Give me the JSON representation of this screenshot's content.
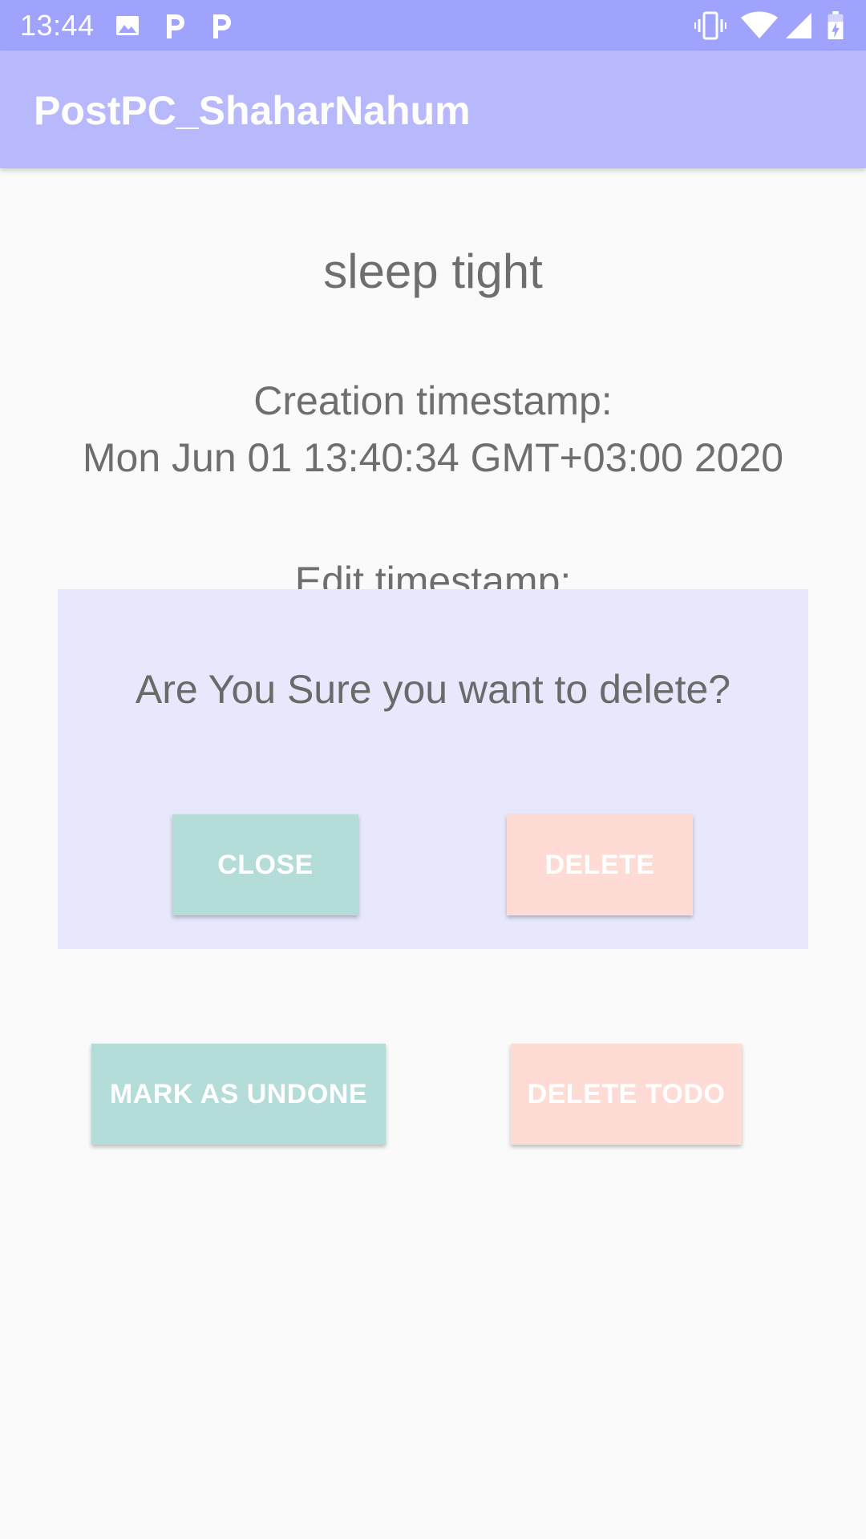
{
  "status_bar": {
    "time": "13:44",
    "icons": [
      "image-icon",
      "parking-icon",
      "parking-icon",
      "vibrate-icon",
      "wifi-icon",
      "signal-icon",
      "battery-icon"
    ]
  },
  "app_bar": {
    "title": "PostPC_ShaharNahum"
  },
  "todo": {
    "title": "sleep tight",
    "creation_label": "Creation timestamp:",
    "creation_value": "Mon Jun 01 13:40:34 GMT+03:00 2020",
    "edit_label": "Edit timestamp:"
  },
  "dialog": {
    "message": "Are You Sure you want to delete?",
    "close_label": "CLOSE",
    "delete_label": "DELETE"
  },
  "actions": {
    "mark_label": "MARK AS UNDONE",
    "delete_todo_label": "DELETE TODO"
  },
  "colors": {
    "status_bar": "#9fa3fd",
    "app_bar": "#b8b9fd",
    "dialog_bg": "#e8e8fd",
    "teal_button": "#b4dcd9",
    "peach_button": "#fedcd5"
  }
}
